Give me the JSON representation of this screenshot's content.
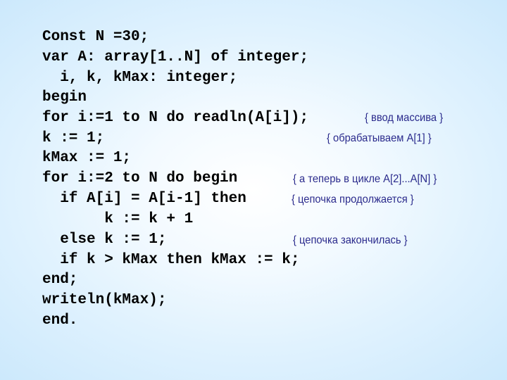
{
  "code_lines": [
    "Const N =30;",
    "var A: array[1..N] of integer;",
    "  i, k, kMax: integer;",
    "begin",
    "for i:=1 to N do readln(A[i]);",
    "k := 1;",
    "kMax := 1;",
    "for i:=2 to N do begin",
    "  if A[i] = A[i-1] then",
    "       k := k + 1",
    "  else k := 1;",
    "  if k > kMax then kMax := k;",
    "end;",
    "writeln(kMax);",
    "end."
  ],
  "comments": {
    "input_array": "{ ввод массива }",
    "process_first": "{ обрабатываем A[1] }",
    "loop_rest": "{ а теперь в цикле A[2]...A[N] }",
    "chain_continues": "{ цепочка продолжается }",
    "chain_ended": "{ цепочка закончилась }"
  }
}
